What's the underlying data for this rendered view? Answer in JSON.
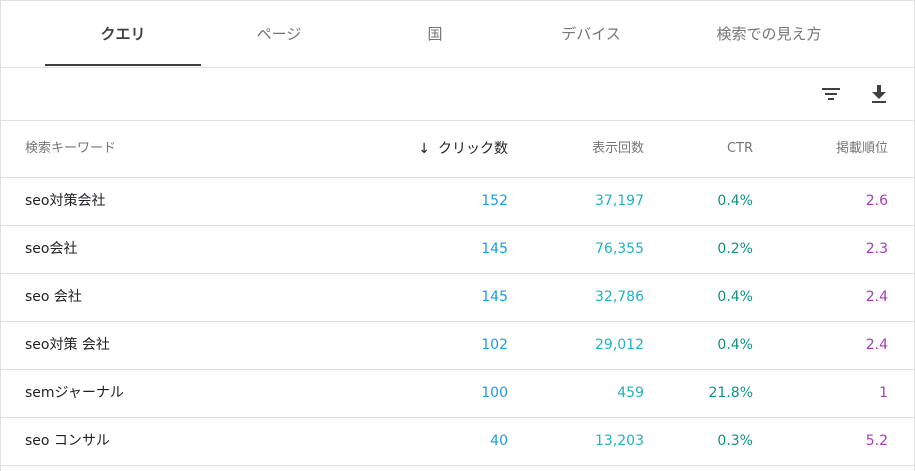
{
  "tabs": [
    {
      "label": "クエリ",
      "active": true
    },
    {
      "label": "ページ",
      "active": false
    },
    {
      "label": "国",
      "active": false
    },
    {
      "label": "デバイス",
      "active": false
    },
    {
      "label": "検索での見え方",
      "active": false
    }
  ],
  "toolbar": {
    "filter_icon": "filter-icon",
    "download_icon": "download-icon"
  },
  "table": {
    "headers": {
      "query": "検索キーワード",
      "clicks": "クリック数",
      "impressions": "表示回数",
      "ctr": "CTR",
      "position": "掲載順位"
    },
    "sort_arrow": "↓",
    "rows": [
      {
        "query": "seo対策会社",
        "clicks": "152",
        "impressions": "37,197",
        "ctr": "0.4%",
        "position": "2.6"
      },
      {
        "query": "seo会社",
        "clicks": "145",
        "impressions": "76,355",
        "ctr": "0.2%",
        "position": "2.3"
      },
      {
        "query": "seo 会社",
        "clicks": "145",
        "impressions": "32,786",
        "ctr": "0.4%",
        "position": "2.4"
      },
      {
        "query": "seo対策 会社",
        "clicks": "102",
        "impressions": "29,012",
        "ctr": "0.4%",
        "position": "2.4"
      },
      {
        "query": "semジャーナル",
        "clicks": "100",
        "impressions": "459",
        "ctr": "21.8%",
        "position": "1"
      },
      {
        "query": "seo コンサル",
        "clicks": "40",
        "impressions": "13,203",
        "ctr": "0.3%",
        "position": "5.2"
      }
    ]
  },
  "colors": {
    "clicks": "#1a9ce6",
    "impressions": "#1fb2c7",
    "ctr": "#0d9488",
    "position": "#a73ab8"
  }
}
